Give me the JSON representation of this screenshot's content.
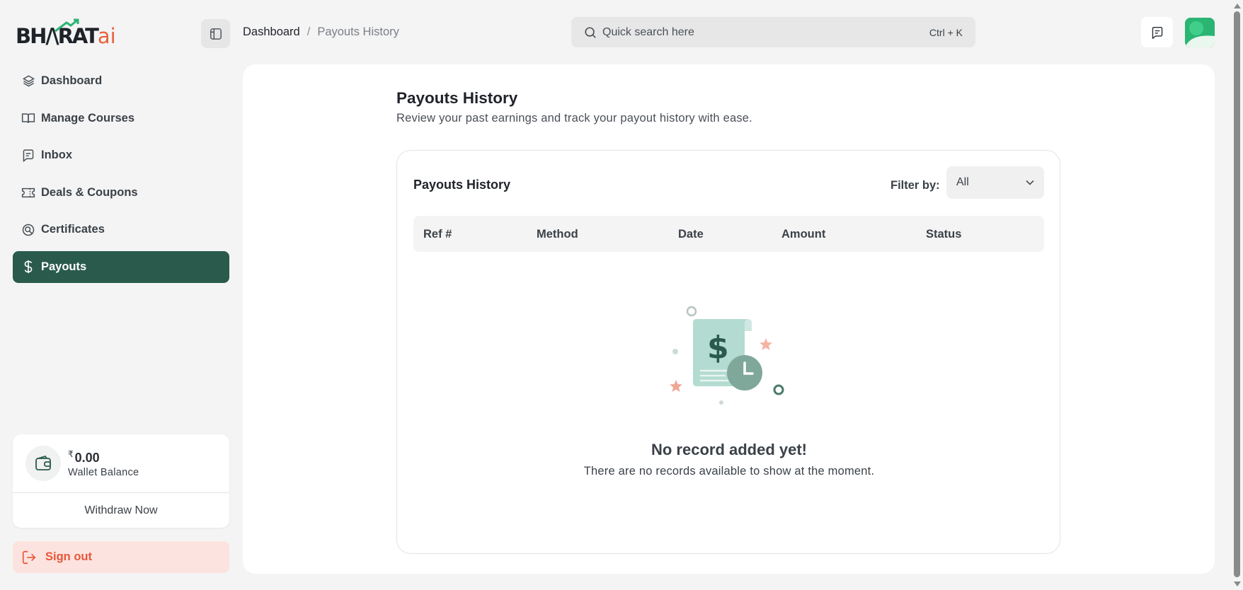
{
  "brand": {
    "logo_main": "BH",
    "logo_mid": "RAT",
    "logo_suffix": "ai"
  },
  "sidebar": {
    "items": [
      {
        "label": "Dashboard",
        "icon": "layers-icon"
      },
      {
        "label": "Manage Courses",
        "icon": "book-icon"
      },
      {
        "label": "Inbox",
        "icon": "message-icon"
      },
      {
        "label": "Deals & Coupons",
        "icon": "ticket-icon"
      },
      {
        "label": "Certificates",
        "icon": "certificate-icon"
      },
      {
        "label": "Payouts",
        "icon": "dollar-icon",
        "active": true
      }
    ],
    "wallet": {
      "currency": "₹",
      "amount": "0.00",
      "label": "Wallet Balance",
      "action": "Withdraw Now"
    },
    "signout": "Sign out"
  },
  "header": {
    "breadcrumb": {
      "home": "Dashboard",
      "separator": "/",
      "current": "Payouts History"
    },
    "search": {
      "placeholder": "Quick search here",
      "shortcut": "Ctrl + K"
    }
  },
  "main": {
    "title": "Payouts History",
    "subtitle": "Review your past earnings and track your payout history with ease.",
    "card": {
      "title": "Payouts History",
      "filter_label": "Filter by:",
      "filter_value": "All",
      "columns": [
        "Ref #",
        "Method",
        "Date",
        "Amount",
        "Status"
      ],
      "empty_title": "No record added yet!",
      "empty_subtitle": "There are no records available to show at the moment."
    }
  },
  "colors": {
    "accent": "#2a5a4c",
    "signout_bg": "#fde3df",
    "signout_text": "#e8553a"
  }
}
